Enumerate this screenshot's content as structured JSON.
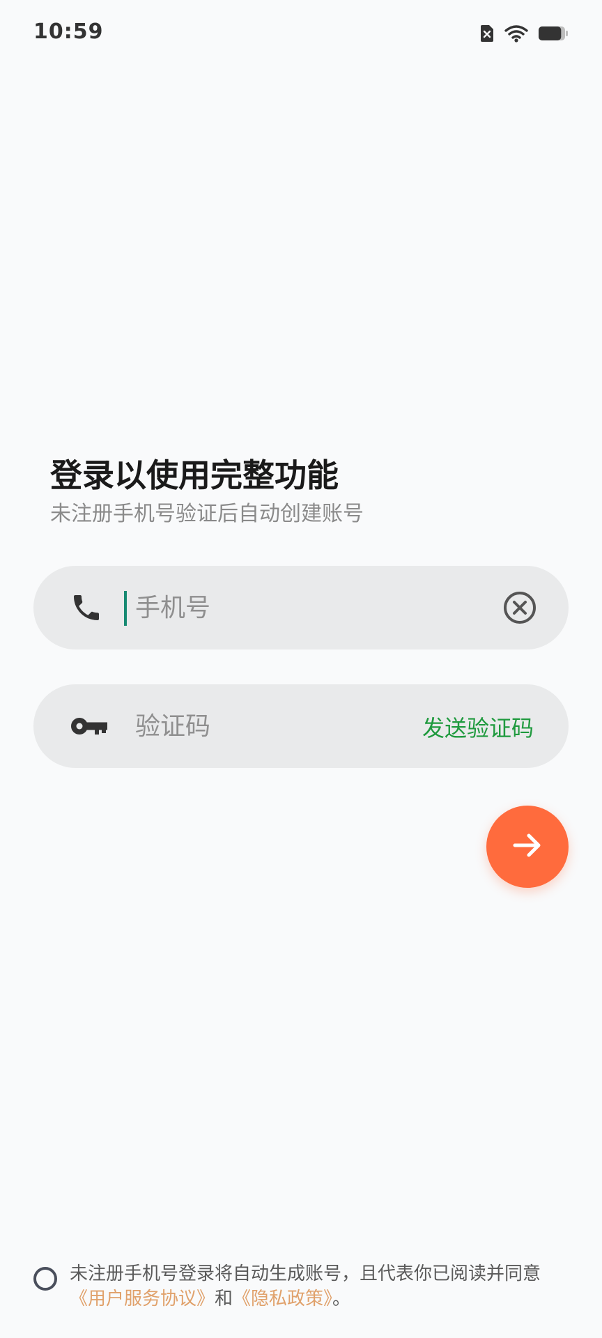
{
  "status_bar": {
    "time": "10:59",
    "icons": [
      "sim-off-icon",
      "wifi-icon",
      "battery-icon"
    ],
    "battery_level": 0.85
  },
  "header": {
    "title": "登录以使用完整功能",
    "subtitle": "未注册手机号验证后自动创建账号"
  },
  "phone_field": {
    "icon": "phone-icon",
    "placeholder": "手机号",
    "value": "",
    "clear_icon": "clear-icon"
  },
  "code_field": {
    "icon": "key-icon",
    "placeholder": "验证码",
    "value": "",
    "send_label": "发送验证码"
  },
  "submit": {
    "icon": "arrow-right-icon"
  },
  "agreement": {
    "checked": false,
    "text_before": "未注册手机号登录将自动生成账号，且代表你已阅读并同意",
    "terms_link": "《用户服务协议》",
    "connector": "和",
    "privacy_link": "《隐私政策》",
    "text_after": "。"
  },
  "colors": {
    "accent": "#ff6b3d",
    "send_code": "#1f9a3e",
    "link": "#e0a16b",
    "caret": "#178a72",
    "field_bg": "#e9eaeb",
    "page_bg": "#f9fafb"
  }
}
